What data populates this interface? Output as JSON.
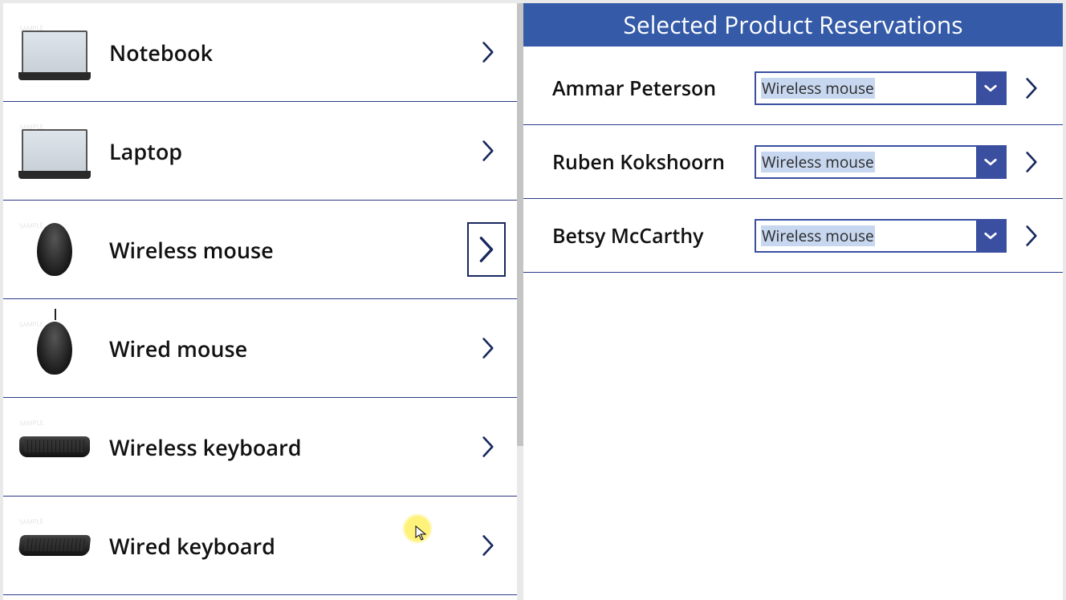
{
  "left": {
    "products": [
      {
        "label": "Notebook",
        "selected": false,
        "thumb": "laptop"
      },
      {
        "label": "Laptop",
        "selected": false,
        "thumb": "laptop"
      },
      {
        "label": "Wireless mouse",
        "selected": true,
        "thumb": "mouse"
      },
      {
        "label": "Wired mouse",
        "selected": false,
        "thumb": "mouse-w"
      },
      {
        "label": "Wireless keyboard",
        "selected": false,
        "thumb": "keyboard"
      },
      {
        "label": "Wired keyboard",
        "selected": false,
        "thumb": "keyboard-w"
      }
    ]
  },
  "right": {
    "header": "Selected Product Reservations",
    "reservations": [
      {
        "name": "Ammar Peterson",
        "dropdown_value": "Wireless mouse"
      },
      {
        "name": "Ruben Kokshoorn",
        "dropdown_value": "Wireless mouse"
      },
      {
        "name": "Betsy McCarthy",
        "dropdown_value": "Wireless mouse"
      }
    ]
  },
  "colors": {
    "accent": "#345aa8",
    "border": "#2b3a8a"
  }
}
